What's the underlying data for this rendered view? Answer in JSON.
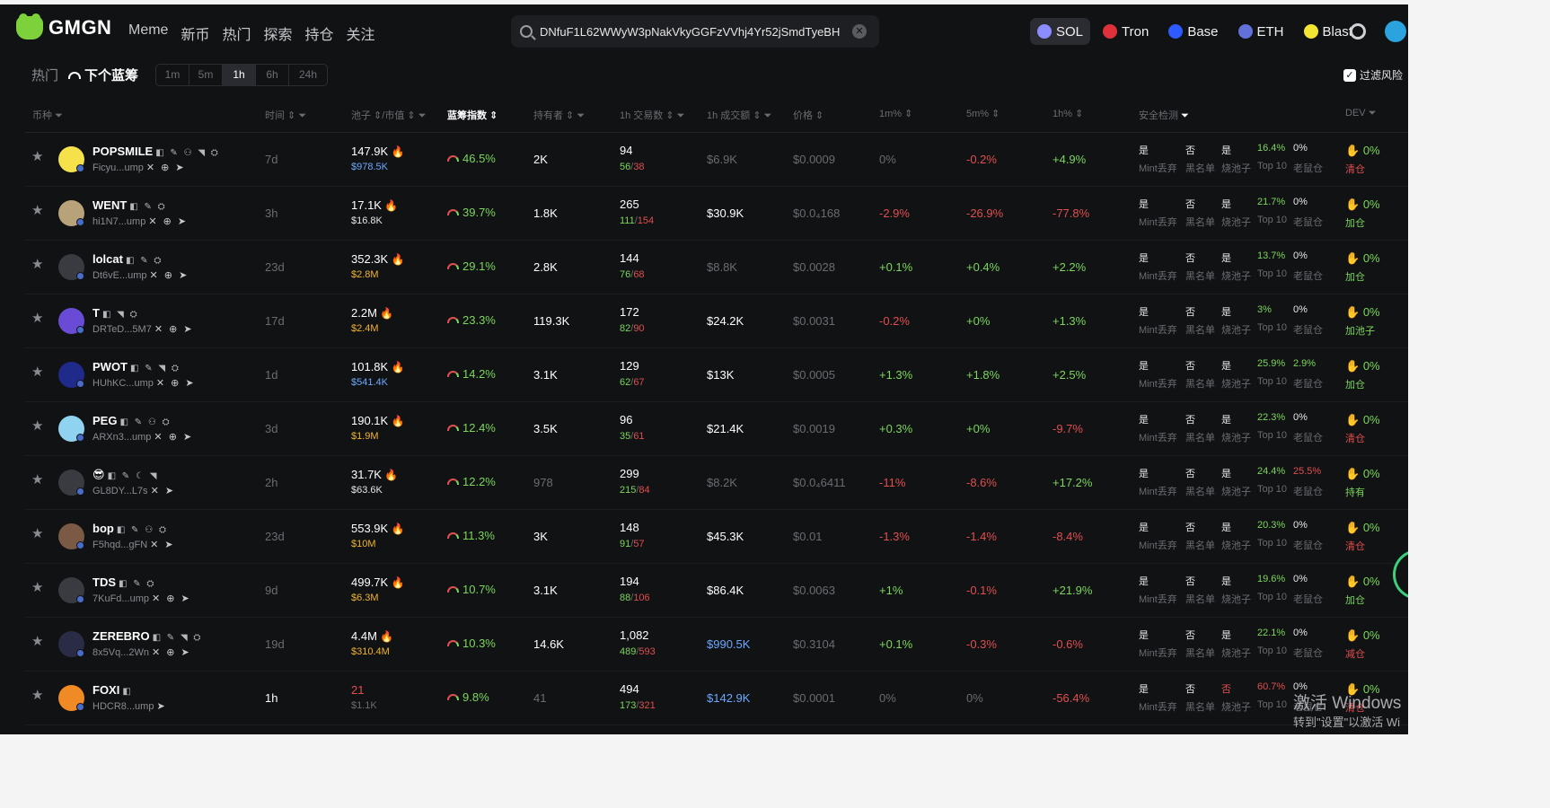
{
  "brand": "GMGN",
  "nav": [
    "Meme",
    "新币",
    "热门",
    "探索",
    "持仓",
    "关注"
  ],
  "search": {
    "value": "DNfuF1L62WWyW3pNakVkyGGFzVVhj4Yr52jSmdTyeBH",
    "clear_icon": "close-icon"
  },
  "chains": [
    {
      "label": "SOL",
      "color": "#8b8cff",
      "active": true
    },
    {
      "label": "Tron",
      "color": "#e0303a",
      "active": false
    },
    {
      "label": "Base",
      "color": "#2d5bff",
      "active": false
    },
    {
      "label": "ETH",
      "color": "#6270d9",
      "active": false
    },
    {
      "label": "Blast",
      "color": "#f3e532",
      "active": false
    }
  ],
  "toolbar": {
    "title": "热门",
    "subtitle": "下个蓝筹",
    "timeframes": [
      "1m",
      "5m",
      "1h",
      "6h",
      "24h"
    ],
    "active_timeframe": "1h",
    "risk_filter": "过滤风险",
    "risk_checked": true
  },
  "columns": {
    "coin": "币种",
    "age": "时间",
    "liq_mc": "池子 ⇕/市值",
    "bluechip": "蓝筹指数",
    "holders": "持有者",
    "txns": "1h 交易数",
    "volume": "1h 成交额",
    "price": "价格",
    "m1": "1m%",
    "m5": "5m%",
    "h1": "1h%",
    "security": "安全检测",
    "dev": "DEV"
  },
  "security_labels": [
    "Mint丢弃",
    "黑名单",
    "烧池子",
    "Top 10",
    "老鼠仓"
  ],
  "rows": [
    {
      "symbol": "POPSMILE",
      "icons": "◧ ✎ ⚇ ◥ ⛭",
      "addr": "Ficyu...ump",
      "addr_icons": "✕ ⊕ ➤",
      "age": "7d",
      "age_hot": false,
      "liq": "147.9K",
      "mc": "$978.5K",
      "mc_color": "#6ea8ff",
      "bluechip": "46.5%",
      "holders": "2K",
      "holders_dim": false,
      "txns": "94",
      "buys": "56",
      "sells": "38",
      "vol": "$6.9K",
      "vol_color": "#6b6c71",
      "price": "$0.0009",
      "m1": "0%",
      "m1c": "zero",
      "m5": "-0.2%",
      "m5c": "neg",
      "h1": "+4.9%",
      "h1c": "pos",
      "sec_vals": [
        "是",
        "否",
        "是",
        "16.4%",
        "0%"
      ],
      "sec_colors": [
        "",
        "",
        "",
        "#7cd65c",
        ""
      ],
      "dev": "0%",
      "dev_status": "清仓",
      "dev_grn": false,
      "avatar": "#f5e14a"
    },
    {
      "symbol": "WENT",
      "icons": "◧ ✎ ⛭",
      "addr": "hi1N7...ump",
      "addr_icons": "✕ ⊕ ➤",
      "age": "3h",
      "age_hot": false,
      "liq": "17.1K",
      "mc": "$16.8K",
      "mc_color": "#e6e6e6",
      "bluechip": "39.7%",
      "holders": "1.8K",
      "holders_dim": false,
      "txns": "265",
      "buys": "111",
      "sells": "154",
      "vol": "$30.9K",
      "vol_color": "#ffffff",
      "price": "$0.0₄168",
      "m1": "-2.9%",
      "m1c": "neg",
      "m5": "-26.9%",
      "m5c": "neg",
      "h1": "-77.8%",
      "h1c": "neg",
      "sec_vals": [
        "是",
        "否",
        "是",
        "21.7%",
        "0%"
      ],
      "sec_colors": [
        "",
        "",
        "",
        "#7cd65c",
        ""
      ],
      "dev": "0%",
      "dev_status": "加仓",
      "dev_grn": true,
      "avatar": "#b8a27a"
    },
    {
      "symbol": "lolcat",
      "icons": "◧ ✎ ⛭",
      "addr": "Dt6vE...ump",
      "addr_icons": "✕ ⊕ ➤",
      "age": "23d",
      "age_hot": false,
      "liq": "352.3K",
      "mc": "$2.8M",
      "mc_color": "#f0b429",
      "bluechip": "29.1%",
      "holders": "2.8K",
      "holders_dim": false,
      "txns": "144",
      "buys": "76",
      "sells": "68",
      "vol": "$8.8K",
      "vol_color": "#6b6c71",
      "price": "$0.0028",
      "m1": "+0.1%",
      "m1c": "pos",
      "m5": "+0.4%",
      "m5c": "pos",
      "h1": "+2.2%",
      "h1c": "pos",
      "sec_vals": [
        "是",
        "否",
        "是",
        "13.7%",
        "0%"
      ],
      "sec_colors": [
        "",
        "",
        "",
        "#7cd65c",
        ""
      ],
      "dev": "0%",
      "dev_status": "加仓",
      "dev_grn": true,
      "avatar": "#3a3b40"
    },
    {
      "symbol": "T",
      "icons": "◧ ◥ ⛭",
      "addr": "DRTeD...5M7",
      "addr_icons": "✕ ⊕ ➤",
      "age": "17d",
      "age_hot": false,
      "liq": "2.2M",
      "mc": "$2.4M",
      "mc_color": "#f0b429",
      "bluechip": "23.3%",
      "holders": "119.3K",
      "holders_dim": false,
      "txns": "172",
      "buys": "82",
      "sells": "90",
      "vol": "$24.2K",
      "vol_color": "#ffffff",
      "price": "$0.0031",
      "m1": "-0.2%",
      "m1c": "neg",
      "m5": "+0%",
      "m5c": "pos",
      "h1": "+1.3%",
      "h1c": "pos",
      "sec_vals": [
        "是",
        "否",
        "是",
        "3%",
        "0%"
      ],
      "sec_colors": [
        "",
        "",
        "",
        "#7cd65c",
        ""
      ],
      "dev": "0%",
      "dev_status": "加池子",
      "dev_grn": true,
      "avatar": "#6a4bd6"
    },
    {
      "symbol": "PWOT",
      "icons": "◧ ✎ ◥ ⛭",
      "addr": "HUhKC...ump",
      "addr_icons": "✕ ⊕ ➤",
      "age": "1d",
      "age_hot": false,
      "liq": "101.8K",
      "mc": "$541.4K",
      "mc_color": "#6ea8ff",
      "bluechip": "14.2%",
      "holders": "3.1K",
      "holders_dim": false,
      "txns": "129",
      "buys": "62",
      "sells": "67",
      "vol": "$13K",
      "vol_color": "#ffffff",
      "price": "$0.0005",
      "m1": "+1.3%",
      "m1c": "pos",
      "m5": "+1.8%",
      "m5c": "pos",
      "h1": "+2.5%",
      "h1c": "pos",
      "sec_vals": [
        "是",
        "否",
        "是",
        "25.9%",
        "2.9%"
      ],
      "sec_colors": [
        "",
        "",
        "",
        "#7cd65c",
        "#7cd65c"
      ],
      "dev": "0%",
      "dev_status": "加仓",
      "dev_grn": true,
      "avatar": "#1f2a8a"
    },
    {
      "symbol": "PEG",
      "icons": "◧ ✎ ⚇ ⛭",
      "addr": "ARXn3...ump",
      "addr_icons": "✕ ⊕ ➤",
      "age": "3d",
      "age_hot": false,
      "liq": "190.1K",
      "mc": "$1.9M",
      "mc_color": "#f0b429",
      "bluechip": "12.4%",
      "holders": "3.5K",
      "holders_dim": false,
      "txns": "96",
      "buys": "35",
      "sells": "61",
      "vol": "$21.4K",
      "vol_color": "#ffffff",
      "price": "$0.0019",
      "m1": "+0.3%",
      "m1c": "pos",
      "m5": "+0%",
      "m5c": "pos",
      "h1": "-9.7%",
      "h1c": "neg",
      "sec_vals": [
        "是",
        "否",
        "是",
        "22.3%",
        "0%"
      ],
      "sec_colors": [
        "",
        "",
        "",
        "#7cd65c",
        ""
      ],
      "dev": "0%",
      "dev_status": "清仓",
      "dev_grn": false,
      "avatar": "#8fd3f0"
    },
    {
      "symbol": "😎",
      "icons": "◧ ✎ ☾ ◥",
      "addr": "GL8DY...L7s",
      "addr_icons": "✕ ➤",
      "age": "2h",
      "age_hot": false,
      "liq": "31.7K",
      "mc": "$63.6K",
      "mc_color": "#e6e6e6",
      "bluechip": "12.2%",
      "holders": "978",
      "holders_dim": true,
      "txns": "299",
      "buys": "215",
      "sells": "84",
      "vol": "$8.2K",
      "vol_color": "#6b6c71",
      "price": "$0.0₄6411",
      "m1": "-11%",
      "m1c": "neg",
      "m5": "-8.6%",
      "m5c": "neg",
      "h1": "+17.2%",
      "h1c": "pos",
      "sec_vals": [
        "是",
        "否",
        "是",
        "24.4%",
        "25.5%"
      ],
      "sec_colors": [
        "",
        "",
        "",
        "#7cd65c",
        "#e04f4f"
      ],
      "dev": "0%",
      "dev_status": "持有",
      "dev_grn": true,
      "avatar": "#3a3b40"
    },
    {
      "symbol": "bop",
      "icons": "◧ ✎ ⚇ ⛭",
      "addr": "F5hqd...gFN",
      "addr_icons": "✕ ➤",
      "age": "23d",
      "age_hot": false,
      "liq": "553.9K",
      "mc": "$10M",
      "mc_color": "#f0b429",
      "bluechip": "11.3%",
      "holders": "3K",
      "holders_dim": false,
      "txns": "148",
      "buys": "91",
      "sells": "57",
      "vol": "$45.3K",
      "vol_color": "#ffffff",
      "price": "$0.01",
      "m1": "-1.3%",
      "m1c": "neg",
      "m5": "-1.4%",
      "m5c": "neg",
      "h1": "-8.4%",
      "h1c": "neg",
      "sec_vals": [
        "是",
        "否",
        "是",
        "20.3%",
        "0%"
      ],
      "sec_colors": [
        "",
        "",
        "",
        "#7cd65c",
        ""
      ],
      "dev": "0%",
      "dev_status": "清仓",
      "dev_grn": false,
      "avatar": "#7a5a44"
    },
    {
      "symbol": "TDS",
      "icons": "◧ ✎ ⛭",
      "addr": "7KuFd...ump",
      "addr_icons": "✕ ⊕ ➤",
      "age": "9d",
      "age_hot": false,
      "liq": "499.7K",
      "mc": "$6.3M",
      "mc_color": "#f0b429",
      "bluechip": "10.7%",
      "holders": "3.1K",
      "holders_dim": false,
      "txns": "194",
      "buys": "88",
      "sells": "106",
      "vol": "$86.4K",
      "vol_color": "#ffffff",
      "price": "$0.0063",
      "m1": "+1%",
      "m1c": "pos",
      "m5": "-0.1%",
      "m5c": "neg",
      "h1": "+21.9%",
      "h1c": "pos",
      "sec_vals": [
        "是",
        "否",
        "是",
        "19.6%",
        "0%"
      ],
      "sec_colors": [
        "",
        "",
        "",
        "#7cd65c",
        ""
      ],
      "dev": "0%",
      "dev_status": "加仓",
      "dev_grn": true,
      "avatar": "#3a3b40"
    },
    {
      "symbol": "ZEREBRO",
      "icons": "◧ ✎ ◥ ⛭",
      "addr": "8x5Vq...2Wn",
      "addr_icons": "✕ ⊕ ➤",
      "age": "19d",
      "age_hot": false,
      "liq": "4.4M",
      "mc": "$310.4M",
      "mc_color": "#f0b429",
      "bluechip": "10.3%",
      "holders": "14.6K",
      "holders_dim": false,
      "txns": "1,082",
      "buys": "489",
      "sells": "593",
      "vol": "$990.5K",
      "vol_color": "#6ea8ff",
      "price": "$0.3104",
      "m1": "+0.1%",
      "m1c": "pos",
      "m5": "-0.3%",
      "m5c": "neg",
      "h1": "-0.6%",
      "h1c": "neg",
      "sec_vals": [
        "是",
        "否",
        "是",
        "22.1%",
        "0%"
      ],
      "sec_colors": [
        "",
        "",
        "",
        "#7cd65c",
        ""
      ],
      "dev": "0%",
      "dev_status": "减仓",
      "dev_grn": false,
      "avatar": "#2a2b45"
    },
    {
      "symbol": "FOXI",
      "icons": "◧",
      "addr": "HDCR8...ump",
      "addr_icons": "➤",
      "age": "1h",
      "age_hot": true,
      "liq": "21",
      "mc": "$1.1K",
      "mc_color": "#6b6c71",
      "bluechip": "9.8%",
      "holders": "41",
      "holders_dim": true,
      "txns": "494",
      "buys": "173",
      "sells": "321",
      "vol": "$142.9K",
      "vol_color": "#6ea8ff",
      "price": "$0.0001",
      "m1": "0%",
      "m1c": "zero",
      "m5": "0%",
      "m5c": "zero",
      "h1": "-56.4%",
      "h1c": "neg",
      "sec_vals": [
        "是",
        "否",
        "否",
        "60.7%",
        "0%"
      ],
      "sec_colors": [
        "",
        "",
        "#e04f4f",
        "#e04f4f",
        ""
      ],
      "dev": "0%",
      "dev_status": "清仓",
      "dev_grn": false,
      "avatar": "#f08a24",
      "liq_red": true
    },
    {
      "symbol": "",
      "icons": "",
      "addr": "",
      "addr_icons": "",
      "age": "",
      "liq": "",
      "mc": "",
      "bluechip": "",
      "holders": "",
      "txns": "",
      "buys": "",
      "sells": "",
      "vol": "",
      "price": "",
      "m1": "",
      "m5": "",
      "h1": "",
      "sec_vals": [],
      "sec_colors": [],
      "dev": "",
      "dev_status": "",
      "avatar": "#111214",
      "empty": true
    }
  ],
  "watermark": {
    "line1": "激活 Windows",
    "line2": "转到\"设置\"以激活 Wi"
  }
}
